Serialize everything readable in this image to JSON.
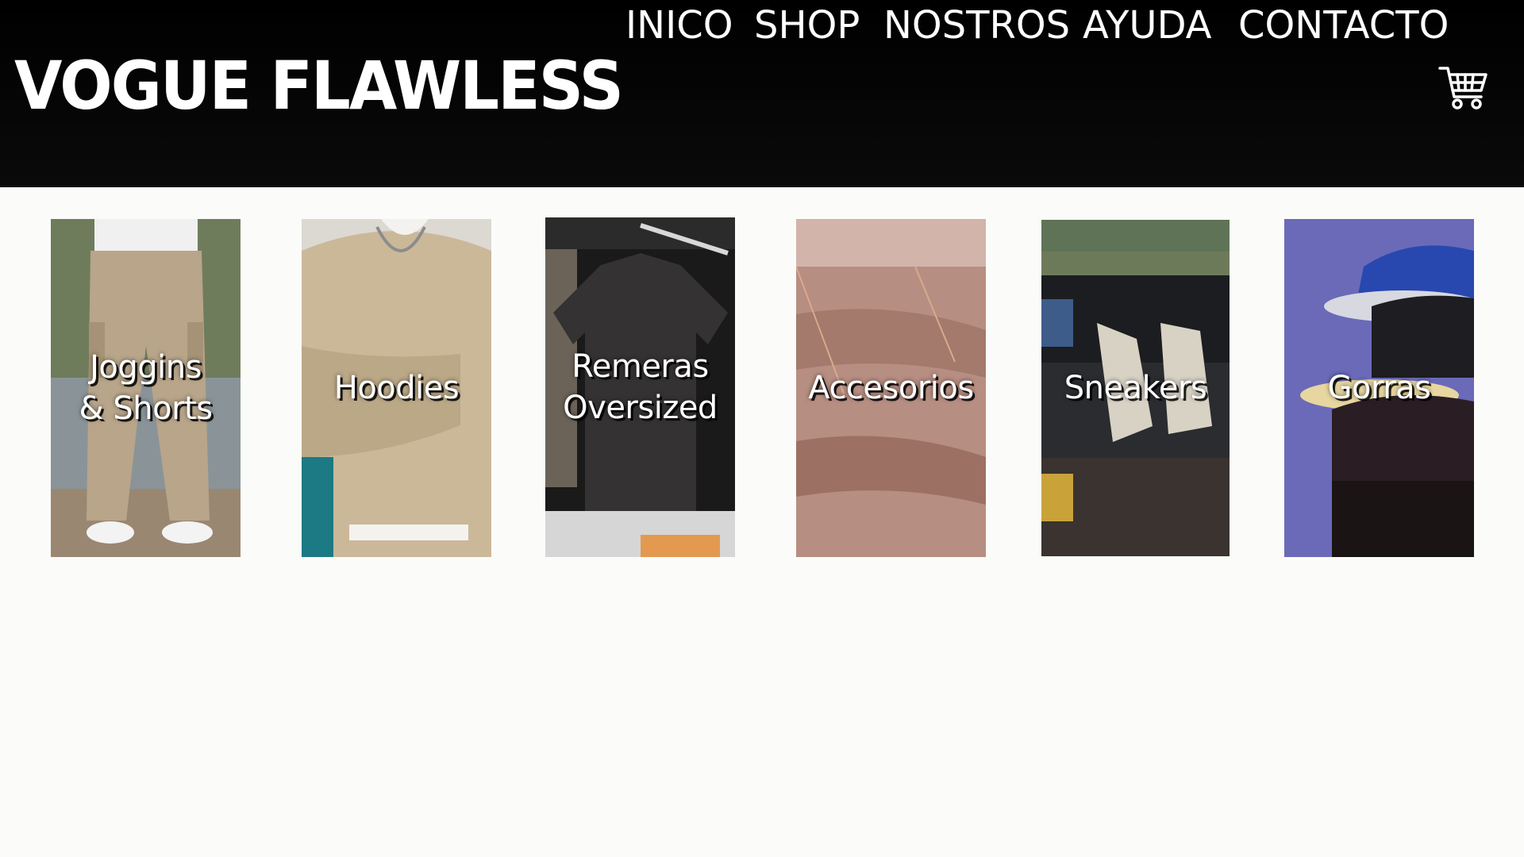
{
  "brand": {
    "name": "VOGUE FLAWLESS"
  },
  "nav": {
    "items": [
      {
        "label": "INICO"
      },
      {
        "label": "SHOP"
      },
      {
        "label": "NOSTROS"
      },
      {
        "label": "AYUDA"
      },
      {
        "label": "CONTACTO"
      }
    ],
    "cart_icon": "shopping-cart-icon"
  },
  "categories": [
    {
      "label": "Joggins\n& Shorts",
      "image": "cargo-pants-photo"
    },
    {
      "label": "Hoodies",
      "image": "beige-sweatshirt-photo"
    },
    {
      "label": "Remeras\nOversized",
      "image": "black-tshirt-photo"
    },
    {
      "label": "Accesorios",
      "image": "name-necklace-photo"
    },
    {
      "label": "Sneakers",
      "image": "sneakers-car-photo"
    },
    {
      "label": "Gorras",
      "image": "caps-photo"
    }
  ],
  "colors": {
    "header_bg": "#000000",
    "page_bg": "#fbfcf9",
    "text_light": "#ffffff"
  }
}
